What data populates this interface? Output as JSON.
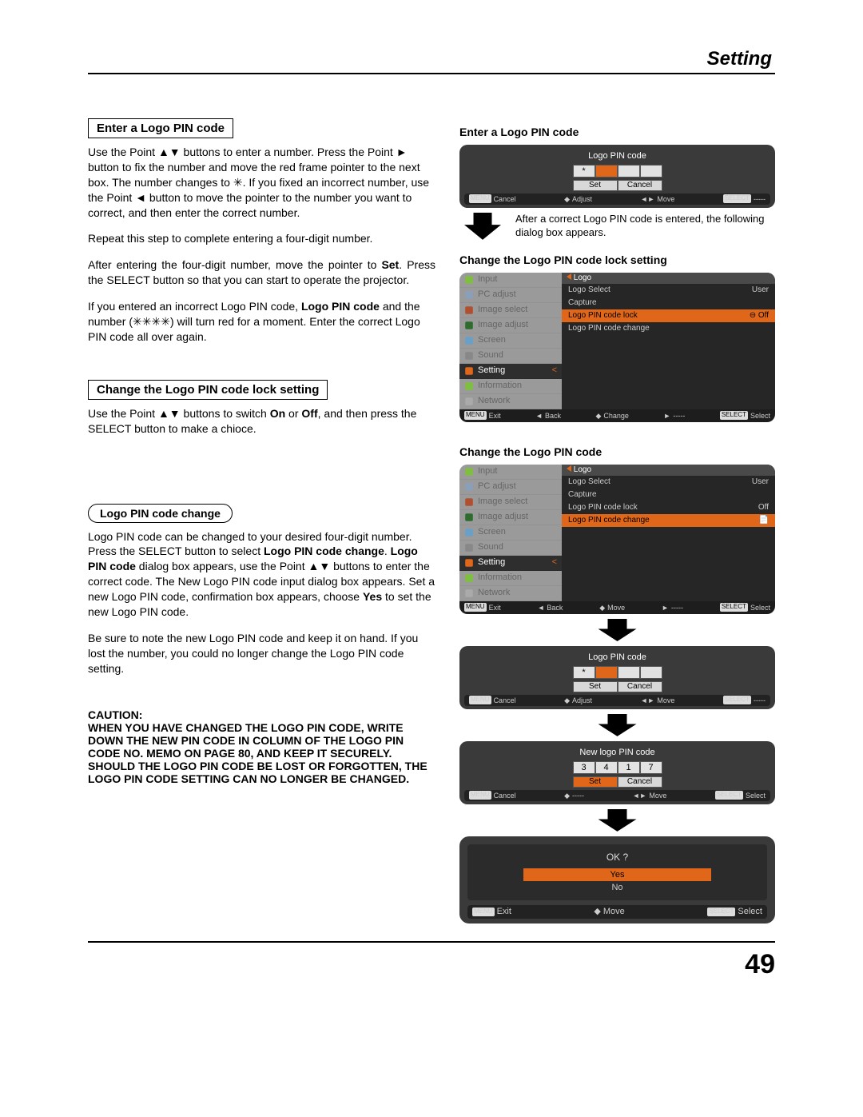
{
  "header": {
    "title": "Setting"
  },
  "page_number": "49",
  "left": {
    "h1": "Enter a Logo PIN code",
    "p1": "Use the Point ▲▼ buttons to enter a number. Press the Point ► button to fix the number and move the red frame pointer to the next box. The number changes to ✳. If you fixed an incorrect number, use the Point ◄ button to move the pointer to the number you want to correct, and then enter the correct number.",
    "p2": "Repeat this step to complete entering a four-digit number.",
    "p3_a": "After entering the four-digit number, move the pointer to ",
    "p3_b": "Set",
    "p3_c": ". Press the SELECT button so that you can start to operate the projector.",
    "p4_a": "If you entered an incorrect Logo PIN code, ",
    "p4_b": "Logo PIN code",
    "p4_c": " and the number (✳✳✳✳) will turn red for a moment. Enter the correct Logo PIN code all over again.",
    "h2": "Change the Logo PIN code lock setting",
    "p5_a": "Use the Point ▲▼ buttons to switch ",
    "p5_b": "On",
    "p5_c": " or ",
    "p5_d": "Off",
    "p5_e": ", and then press the SELECT button to make a chioce.",
    "h3": "Logo PIN code change",
    "p6_a": "Logo PIN code can be changed to your desired four-digit number. Press the SELECT button to select ",
    "p6_b": "Logo PIN code change",
    "p6_c": ". ",
    "p6_d": "Logo PIN code",
    "p6_e": " dialog box appears, use the Point ▲▼ buttons to enter the correct code. The New Logo PIN code input dialog box appears. Set a new Logo PIN code, confirmation box appears, choose ",
    "p6_f": "Yes",
    "p6_g": " to set the new Logo PIN code.",
    "p7": "Be sure to note the new Logo PIN code and keep it on hand. If you lost the number, you could no longer change the Logo PIN code setting.",
    "caution_label": "CAUTION:",
    "caution_text": "WHEN YOU HAVE CHANGED THE LOGO PIN CODE, WRITE DOWN THE NEW PIN CODE IN COLUMN OF THE LOGO PIN CODE NO. MEMO ON PAGE 80, AND KEEP IT SECURELY. SHOULD THE LOGO PIN CODE BE LOST OR FORGOTTEN, THE LOGO PIN CODE SETTING CAN NO LONGER BE CHANGED."
  },
  "right": {
    "h1": "Enter a Logo PIN code",
    "osd1": {
      "title": "Logo PIN code",
      "pin": [
        "*",
        "",
        "",
        ""
      ],
      "set": "Set",
      "cancel": "Cancel",
      "status": {
        "menu": "MENU",
        "cancel": "Cancel",
        "adjust": "Adjust",
        "move": "Move",
        "select": "SELECT",
        "dashes": "-----"
      }
    },
    "arrow_text": "After a correct Logo PIN code is entered, the following dialog box appears.",
    "h2": "Change the Logo PIN code lock setting",
    "menu": {
      "left_items": [
        "Input",
        "PC adjust",
        "Image select",
        "Image adjust",
        "Screen",
        "Sound",
        "Setting",
        "Information",
        "Network"
      ],
      "header": "Logo",
      "rows_lock": [
        {
          "l": "Logo Select",
          "r": "User"
        },
        {
          "l": "Capture",
          "r": ""
        },
        {
          "l": "Logo PIN code lock",
          "r": "Off",
          "hl": true,
          "icon": true
        },
        {
          "l": "Logo PIN code change",
          "r": ""
        }
      ],
      "rows_change": [
        {
          "l": "Logo Select",
          "r": "User"
        },
        {
          "l": "Capture",
          "r": ""
        },
        {
          "l": "Logo PIN code lock",
          "r": "Off"
        },
        {
          "l": "Logo PIN code change",
          "r": "",
          "hl": true,
          "doc": true
        }
      ],
      "status": {
        "menu": "MENU",
        "exit": "Exit",
        "back": "Back",
        "change": "Change",
        "arrow": "-----",
        "select": "SELECT",
        "selectlbl": "Select",
        "move": "Move"
      }
    },
    "h3": "Change the Logo PIN code",
    "osd2": {
      "title": "Logo PIN code",
      "pin": [
        "*",
        "",
        "",
        ""
      ],
      "set": "Set",
      "cancel": "Cancel",
      "status": {
        "menu": "MENU",
        "cancel": "Cancel",
        "adjust": "Adjust",
        "move": "Move",
        "select": "SELECT",
        "dashes": "-----"
      }
    },
    "osd3": {
      "title": "New logo PIN code",
      "pin": [
        "3",
        "4",
        "1",
        "7"
      ],
      "set": "Set",
      "cancel": "Cancel",
      "status": {
        "menu": "MENU",
        "cancel": "Cancel",
        "dashes": "-----",
        "move": "Move",
        "select": "SELECT",
        "selectlbl": "Select"
      }
    },
    "okosd": {
      "q": "OK ?",
      "yes": "Yes",
      "no": "No",
      "status": {
        "menu": "MENU",
        "exit": "Exit",
        "move": "Move",
        "select": "SELECT",
        "selectlbl": "Select"
      }
    }
  }
}
